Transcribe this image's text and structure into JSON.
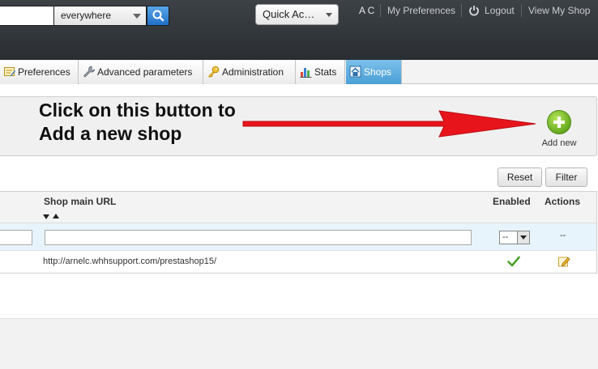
{
  "header": {
    "search": {
      "value": "",
      "scope": "everywhere"
    },
    "quick_access": "Quick Ac…",
    "user_initials": "A C",
    "links": {
      "preferences": "My Preferences",
      "logout": "Logout",
      "view_shop": "View My Shop"
    }
  },
  "tabs": [
    {
      "label": "Preferences",
      "icon": "preferences-icon"
    },
    {
      "label": "Advanced parameters",
      "icon": "wrench-icon"
    },
    {
      "label": "Administration",
      "icon": "key-icon"
    },
    {
      "label": "Stats",
      "icon": "bar-chart-icon"
    },
    {
      "label": "Shops",
      "icon": "shop-icon",
      "active": true
    }
  ],
  "toolbar": {
    "callout_line1": "Click on this button to",
    "callout_line2": "Add a new shop",
    "add_new_label": "Add new",
    "arrow_color": "#e8141b"
  },
  "list": {
    "reset_label": "Reset",
    "filter_label": "Filter",
    "columns": {
      "url": "Shop main URL",
      "enabled": "Enabled",
      "actions": "Actions"
    },
    "enabled_filter": "--",
    "actions_filter": "--",
    "rows": [
      {
        "url": "http://arnelc.whhsupport.com/prestashop15/",
        "enabled": true
      }
    ]
  },
  "colors": {
    "header_bg": "#2f3337",
    "active_tab": "#5aa9dd",
    "filter_row": "#e8f4fb"
  }
}
